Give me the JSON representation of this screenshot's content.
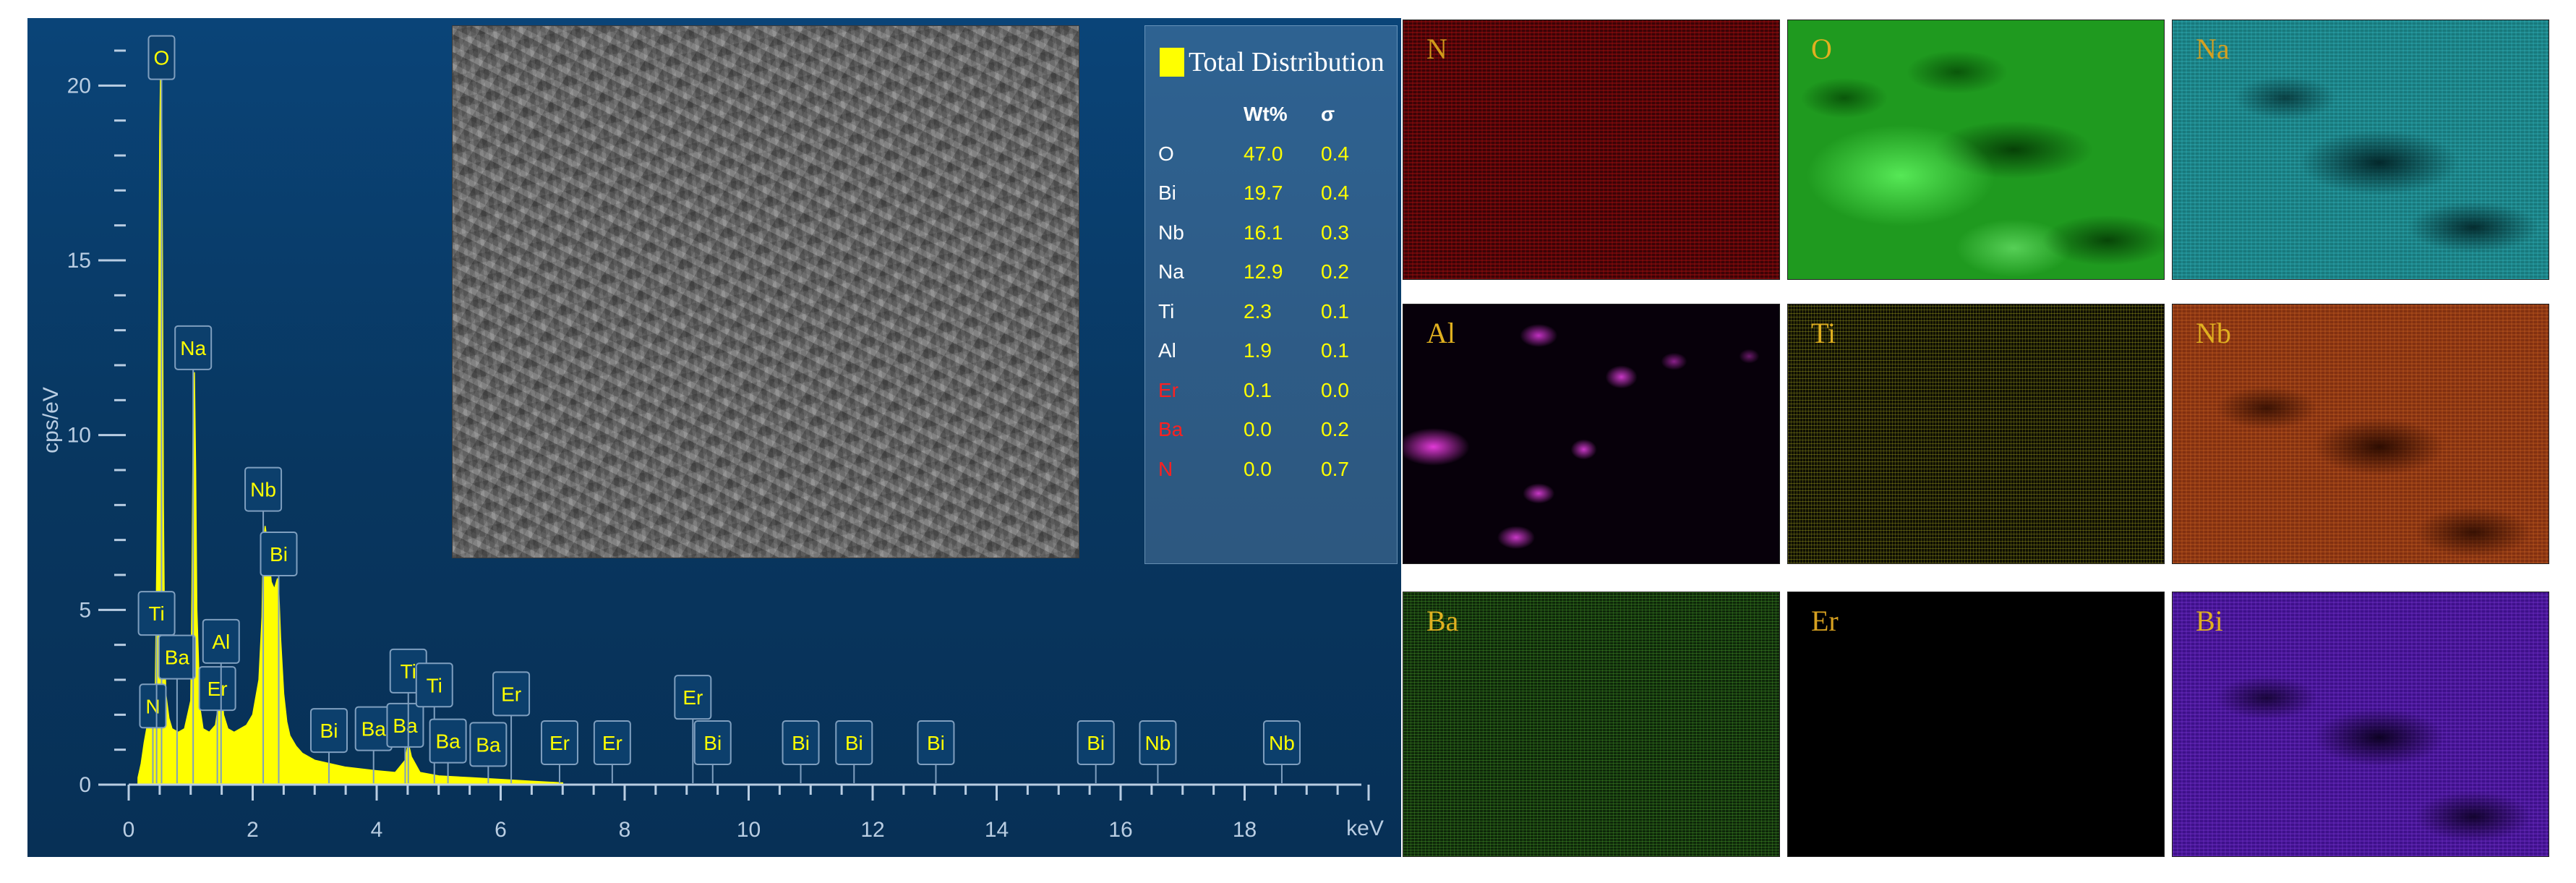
{
  "colors": {
    "panel_background": "#0a4478",
    "spectrum_fill": "#ffff00",
    "axis": "#b9cde2",
    "label_box_border": "#7f9fbf",
    "label_text": "#ffff00"
  },
  "chart_data": {
    "type": "area",
    "xlabel": "keV",
    "ylabel": "cps/eV",
    "xlim": [
      0,
      20
    ],
    "ylim": [
      0,
      21
    ],
    "x_ticks": [
      "0",
      "2",
      "4",
      "6",
      "8",
      "10",
      "12",
      "14",
      "16",
      "18"
    ],
    "y_ticks": [
      "0",
      "5",
      "10",
      "15",
      "20"
    ],
    "grid": false,
    "spectrum": {
      "x": [
        0.15,
        0.2,
        0.25,
        0.3,
        0.35,
        0.39,
        0.43,
        0.47,
        0.5,
        0.52,
        0.53,
        0.545,
        0.56,
        0.58,
        0.6,
        0.65,
        0.7,
        0.8,
        0.9,
        1.0,
        1.02,
        1.04,
        1.06,
        1.08,
        1.1,
        1.15,
        1.2,
        1.3,
        1.4,
        1.45,
        1.49,
        1.53,
        1.6,
        1.7,
        1.8,
        1.9,
        2.0,
        2.1,
        2.15,
        2.17,
        2.2,
        2.25,
        2.3,
        2.35,
        2.4,
        2.42,
        2.45,
        2.5,
        2.55,
        2.6,
        2.7,
        2.8,
        3.0,
        3.5,
        4.0,
        4.3,
        4.46,
        4.51,
        4.56,
        4.7,
        5.0,
        5.5,
        6.0,
        6.5,
        7.0
      ],
      "y": [
        0.2,
        0.6,
        1.2,
        1.7,
        1.8,
        1.5,
        2.8,
        9.0,
        18.5,
        21.2,
        20.5,
        15.0,
        8.0,
        4.0,
        2.6,
        1.9,
        1.6,
        1.5,
        1.6,
        2.4,
        5.5,
        10.3,
        11.8,
        9.0,
        5.0,
        2.2,
        1.6,
        1.5,
        1.7,
        2.3,
        3.0,
        2.0,
        1.6,
        1.5,
        1.6,
        1.7,
        2.0,
        3.0,
        4.8,
        6.8,
        7.4,
        6.8,
        5.8,
        5.6,
        5.9,
        5.6,
        4.2,
        2.6,
        1.8,
        1.4,
        1.1,
        0.9,
        0.7,
        0.5,
        0.4,
        0.35,
        0.7,
        1.2,
        0.8,
        0.35,
        0.25,
        0.2,
        0.15,
        0.1,
        0.05
      ]
    },
    "peak_labels": [
      {
        "text": "O",
        "x": 0.53,
        "y": 20.8
      },
      {
        "text": "N",
        "x": 0.39,
        "y": 2.25
      },
      {
        "text": "Ti",
        "x": 0.45,
        "y": 4.9
      },
      {
        "text": "Ba",
        "x": 0.78,
        "y": 3.65
      },
      {
        "text": "Na",
        "x": 1.04,
        "y": 12.5
      },
      {
        "text": "Er",
        "x": 1.43,
        "y": 2.75
      },
      {
        "text": "Al",
        "x": 1.49,
        "y": 4.1
      },
      {
        "text": "Nb",
        "x": 2.17,
        "y": 8.45
      },
      {
        "text": "Bi",
        "x": 2.42,
        "y": 6.6
      },
      {
        "text": "Bi",
        "x": 3.23,
        "y": 1.55
      },
      {
        "text": "Ba",
        "x": 3.95,
        "y": 1.6
      },
      {
        "text": "Ba",
        "x": 4.46,
        "y": 1.7
      },
      {
        "text": "Ti",
        "x": 4.51,
        "y": 3.25
      },
      {
        "text": "Ti",
        "x": 4.93,
        "y": 2.85
      },
      {
        "text": "Ba",
        "x": 5.15,
        "y": 1.25
      },
      {
        "text": "Ba",
        "x": 5.8,
        "y": 1.15
      },
      {
        "text": "Er",
        "x": 6.17,
        "y": 2.6
      },
      {
        "text": "Er",
        "x": 6.95,
        "y": 1.2
      },
      {
        "text": "Er",
        "x": 7.8,
        "y": 1.2
      },
      {
        "text": "Er",
        "x": 9.1,
        "y": 2.5
      },
      {
        "text": "Bi",
        "x": 9.42,
        "y": 1.2
      },
      {
        "text": "Bi",
        "x": 10.84,
        "y": 1.2
      },
      {
        "text": "Bi",
        "x": 11.7,
        "y": 1.2
      },
      {
        "text": "Bi",
        "x": 13.02,
        "y": 1.2
      },
      {
        "text": "Bi",
        "x": 15.6,
        "y": 1.2
      },
      {
        "text": "Nb",
        "x": 16.6,
        "y": 1.2
      },
      {
        "text": "Nb",
        "x": 18.6,
        "y": 1.2
      }
    ]
  },
  "distribution": {
    "title": "Total Distribution",
    "col_wt": "Wt%",
    "col_sigma": "σ",
    "rows": [
      {
        "element": "O",
        "wt": "47.0",
        "sigma": "0.4"
      },
      {
        "element": "Bi",
        "wt": "19.7",
        "sigma": "0.4"
      },
      {
        "element": "Nb",
        "wt": "16.1",
        "sigma": "0.3"
      },
      {
        "element": "Na",
        "wt": "12.9",
        "sigma": "0.2"
      },
      {
        "element": "Ti",
        "wt": "2.3",
        "sigma": "0.1"
      },
      {
        "element": "Al",
        "wt": "1.9",
        "sigma": "0.1"
      },
      {
        "element": "Er",
        "wt": "0.1",
        "sigma": "0.0"
      },
      {
        "element": "Ba",
        "wt": "0.0",
        "sigma": "0.2"
      },
      {
        "element": "N",
        "wt": "0.0",
        "sigma": "0.7"
      }
    ]
  },
  "maps": [
    {
      "label": "N",
      "label_color": "#d09a1a"
    },
    {
      "label": "O",
      "label_color": "#e0b020"
    },
    {
      "label": "Na",
      "label_color": "#d6a020"
    },
    {
      "label": "Al",
      "label_color": "#e0b020"
    },
    {
      "label": "Ti",
      "label_color": "#e0b020"
    },
    {
      "label": "Nb",
      "label_color": "#e0b020"
    },
    {
      "label": "Ba",
      "label_color": "#e0b020"
    },
    {
      "label": "Er",
      "label_color": "#d6a020"
    },
    {
      "label": "Bi",
      "label_color": "#e0b020"
    }
  ]
}
